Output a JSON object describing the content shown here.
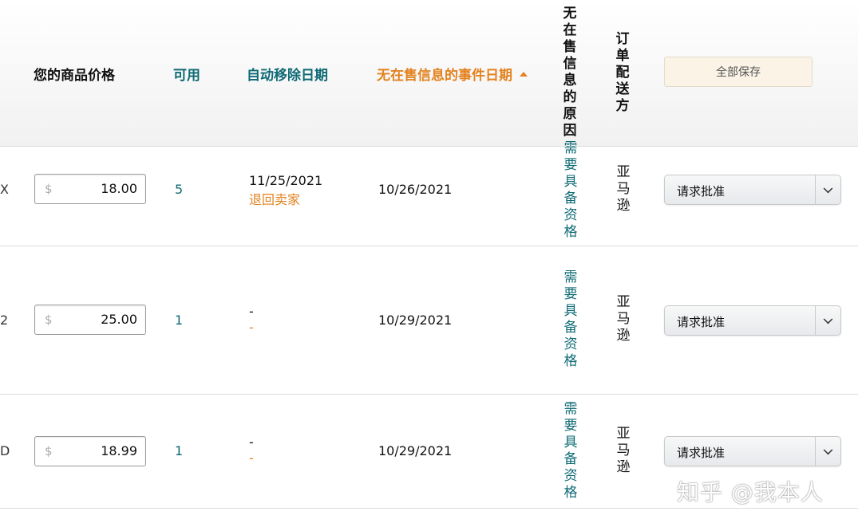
{
  "header": {
    "price": "您的商品价格",
    "available": "可用",
    "auto_remove_date": "自动移除日期",
    "event_date": "无在售信息的事件日期",
    "reason": "无\n在\n售\n信\n息\n的\n原\n因",
    "shipped_by": "订\n单\n配\n送\n方",
    "save_all": "全部保存"
  },
  "rows": [
    {
      "sku_tail": "X",
      "currency": "$",
      "price": "18.00",
      "available": "5",
      "remove_date": "11/25/2021",
      "remove_note": "退回卖家",
      "event_date": "10/26/2021",
      "reason": "需\n要\n具\n备\n资\n格",
      "shipped_by": "亚\n马\n逊",
      "action": "请求批准"
    },
    {
      "sku_tail": "2",
      "currency": "$",
      "price": "25.00",
      "available": "1",
      "remove_date": "-",
      "remove_note": "-",
      "event_date": "10/29/2021",
      "reason": "需\n要\n具\n备\n资\n格",
      "shipped_by": "亚\n马\n逊",
      "action": "请求批准"
    },
    {
      "sku_tail": "D",
      "currency": "$",
      "price": "18.99",
      "available": "1",
      "remove_date": "-",
      "remove_note": "-",
      "event_date": "10/29/2021",
      "reason": "需\n要\n具\n备\n资\n格",
      "shipped_by": "亚\n马\n逊",
      "action": "请求批准"
    }
  ],
  "watermark": "知乎 @我本人",
  "colors": {
    "link": "#0e6a74",
    "sorted": "#e3821f"
  },
  "icons": {
    "sort": "sort-ascending-icon",
    "dropdown": "chevron-down-icon"
  }
}
